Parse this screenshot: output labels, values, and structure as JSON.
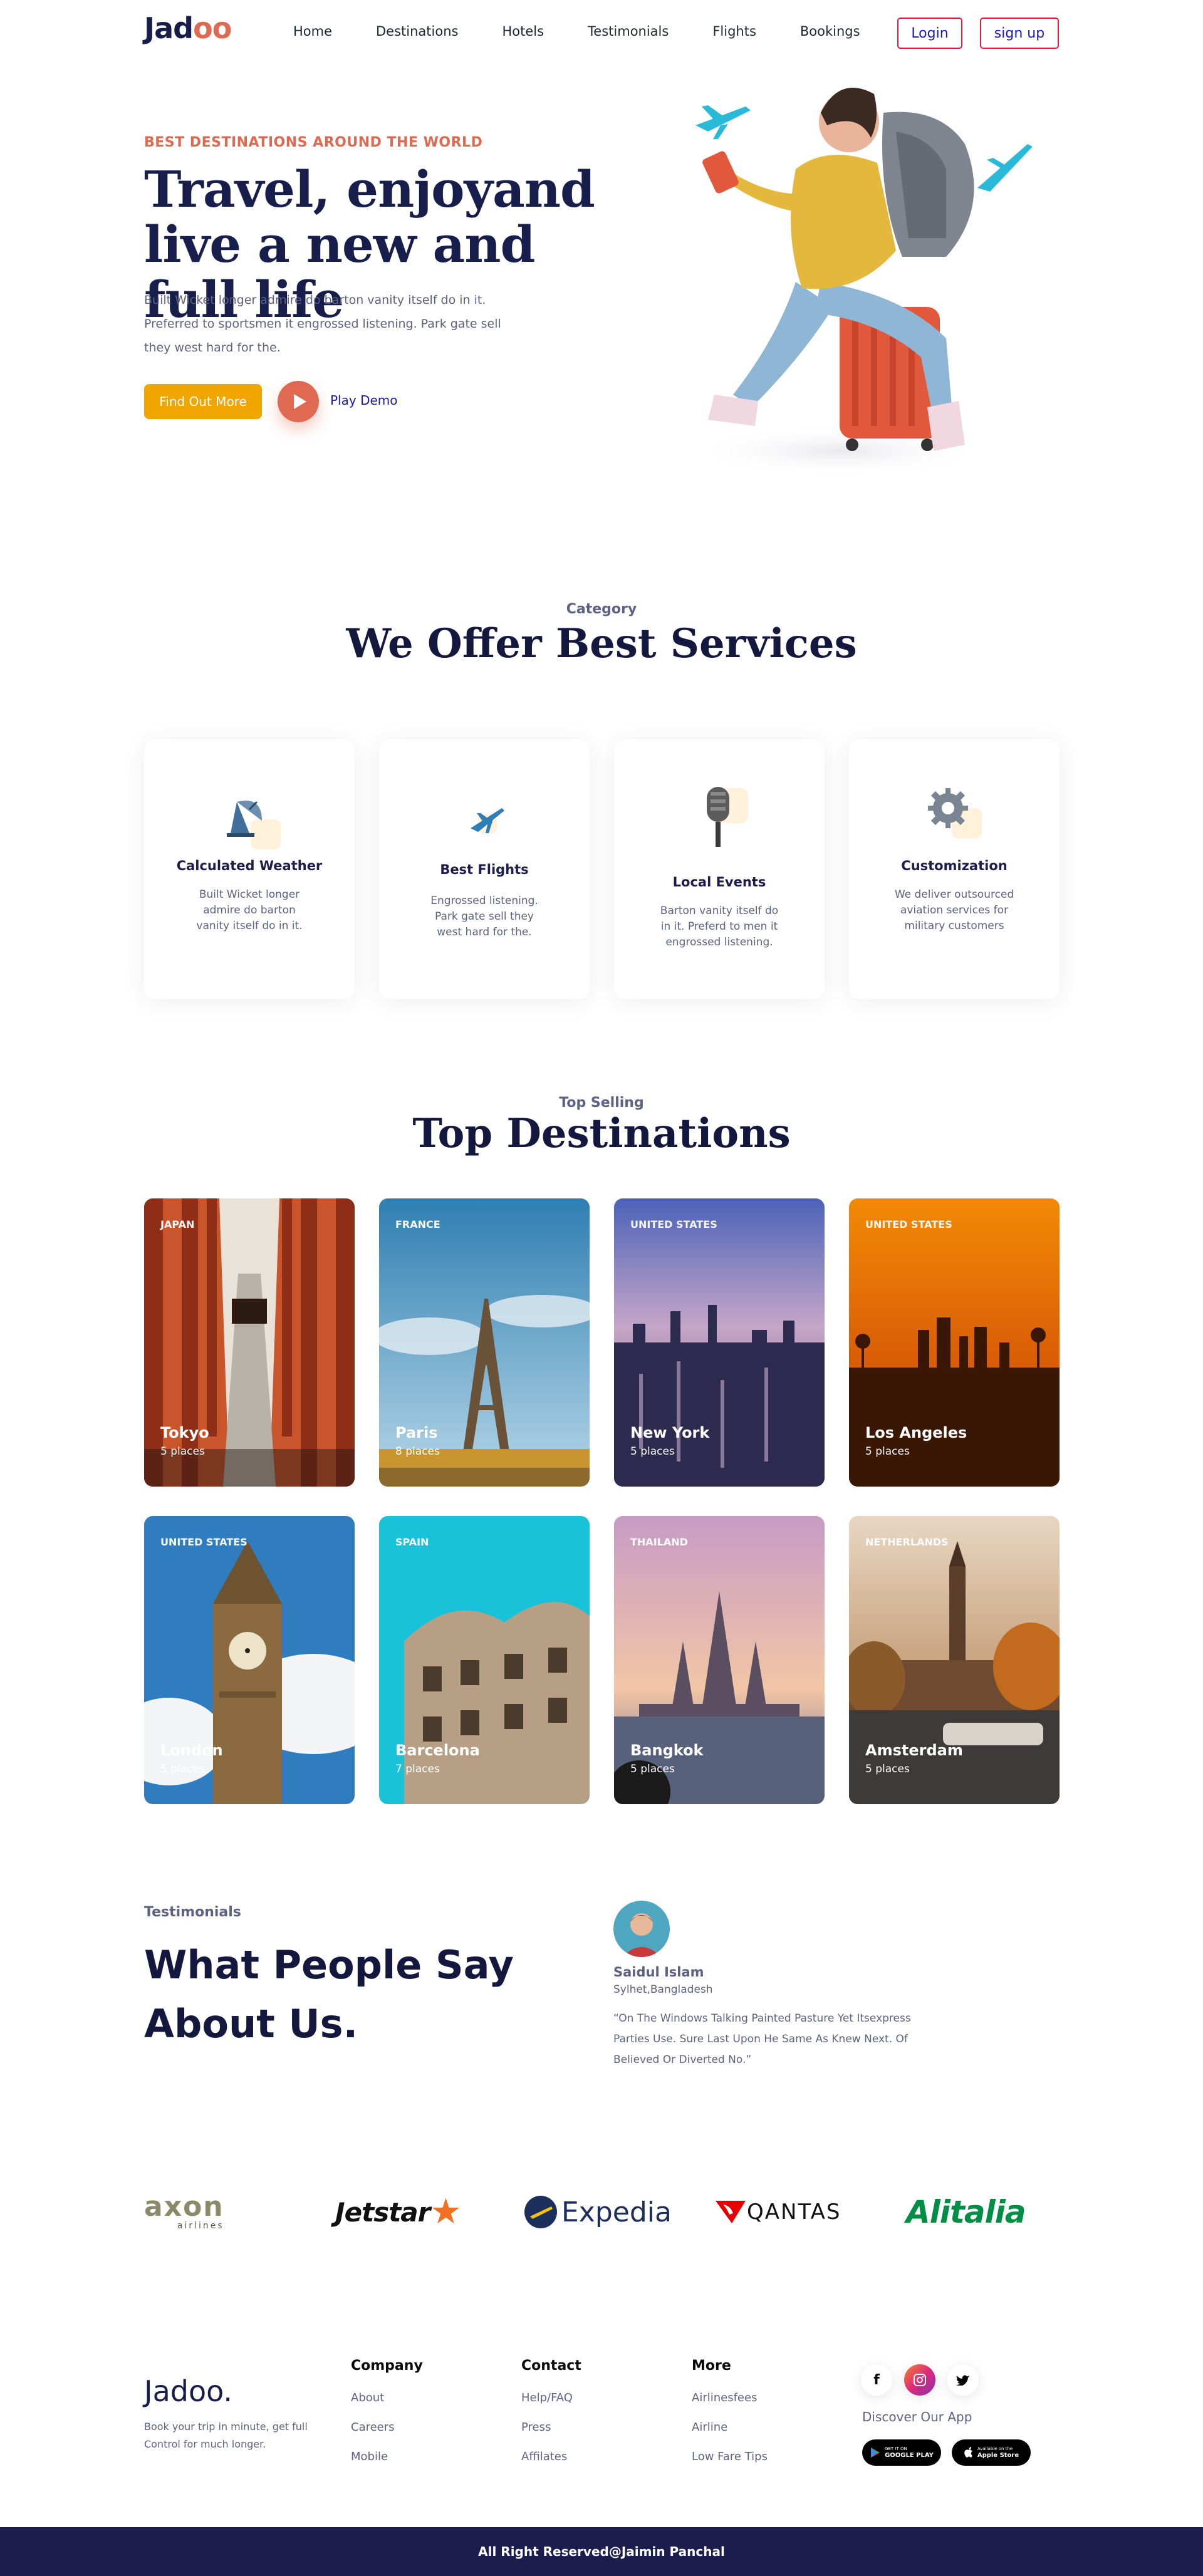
{
  "nav": {
    "logo_prefix": "Jad",
    "logo_suffix": "oo",
    "links": [
      "Home",
      "Destinations",
      "Hotels",
      "Testimonials",
      "Flights",
      "Bookings"
    ],
    "login_label": "Login",
    "signup_label": "sign up"
  },
  "hero": {
    "eyebrow": "BEST DESTINATIONS AROUND THE WORLD",
    "title": "Travel, enjoyand live a new and full life",
    "description": "Built Wicket longer admire do barton vanity itself do in it. Preferred to sportsmen it engrossed listening. Park gate sell they west hard for the.",
    "cta_label": "Find Out More",
    "play_label": "Play Demo"
  },
  "services": {
    "eyebrow": "Category",
    "title": "We Offer Best Services",
    "cards": [
      {
        "title": "Calculated Weather",
        "desc": "Built Wicket longer admire do barton vanity itself do in it.",
        "icon": "satellite-icon"
      },
      {
        "title": "Best Flights",
        "desc": "Engrossed listening. Park gate sell they west hard for the.",
        "icon": "airplane-icon"
      },
      {
        "title": "Local Events",
        "desc": "Barton vanity itself do in it. Preferd to men it engrossed listening.",
        "icon": "microphone-icon"
      },
      {
        "title": "Customization",
        "desc": "We deliver outsourced aviation services for military customers",
        "icon": "gear-icon"
      }
    ]
  },
  "destinations": {
    "eyebrow": "Top Selling",
    "title": "Top Destinations",
    "cards": [
      {
        "country": "JAPAN",
        "city": "Tokyo",
        "places": "5 places"
      },
      {
        "country": "FRANCE",
        "city": "Paris",
        "places": "8 places"
      },
      {
        "country": "UNITED STATES",
        "city": "New York",
        "places": "5 places"
      },
      {
        "country": "UNITED STATES",
        "city": "Los Angeles",
        "places": "5 places"
      },
      {
        "country": "UNITED STATES",
        "city": "London",
        "places": "5 places"
      },
      {
        "country": "SPAIN",
        "city": "Barcelona",
        "places": "7 places"
      },
      {
        "country": "THAILAND",
        "city": "Bangkok",
        "places": "5 places"
      },
      {
        "country": "NETHERLANDS",
        "city": "Amsterdam",
        "places": "5 places"
      }
    ]
  },
  "testimonials": {
    "eyebrow": "Testimonials",
    "title": "What People Say About Us.",
    "name": "Saidul Islam",
    "location": "Sylhet,Bangladesh",
    "quote": "“On The Windows Talking Painted Pasture Yet Itsexpress Parties Use. Sure Last Upon He Same As Knew Next. Of Believed Or Diverted No.”"
  },
  "brands": {
    "axon": "axon",
    "axon_sub": "airlines",
    "jetstar": "Jetstar",
    "expedia": "Expedia",
    "qantas": "QANTAS",
    "alitalia": "Alitalia"
  },
  "footer": {
    "logo": "Jadoo.",
    "tagline": "Book your trip in minute, get full Control for much longer.",
    "company": {
      "heading": "Company",
      "links": [
        "About",
        "Careers",
        "Mobile"
      ]
    },
    "contact": {
      "heading": "Contact",
      "links": [
        "Help/FAQ",
        "Press",
        "Affilates"
      ]
    },
    "more": {
      "heading": "More",
      "links": [
        "Airlinesfees",
        "Airline",
        "Low Fare Tips"
      ]
    },
    "discover": "Discover Our App",
    "google_small": "GET IT ON",
    "google_big": "GOOGLE PLAY",
    "apple_small": "Available on the",
    "apple_big": "Apple Store",
    "copyright": "All Right Reserved@Jaimin Panchal"
  },
  "colors": {
    "accent": "#DF6951",
    "cta": "#F1A501",
    "navy": "#181E4B",
    "footer_bar": "#1C1D4C"
  }
}
